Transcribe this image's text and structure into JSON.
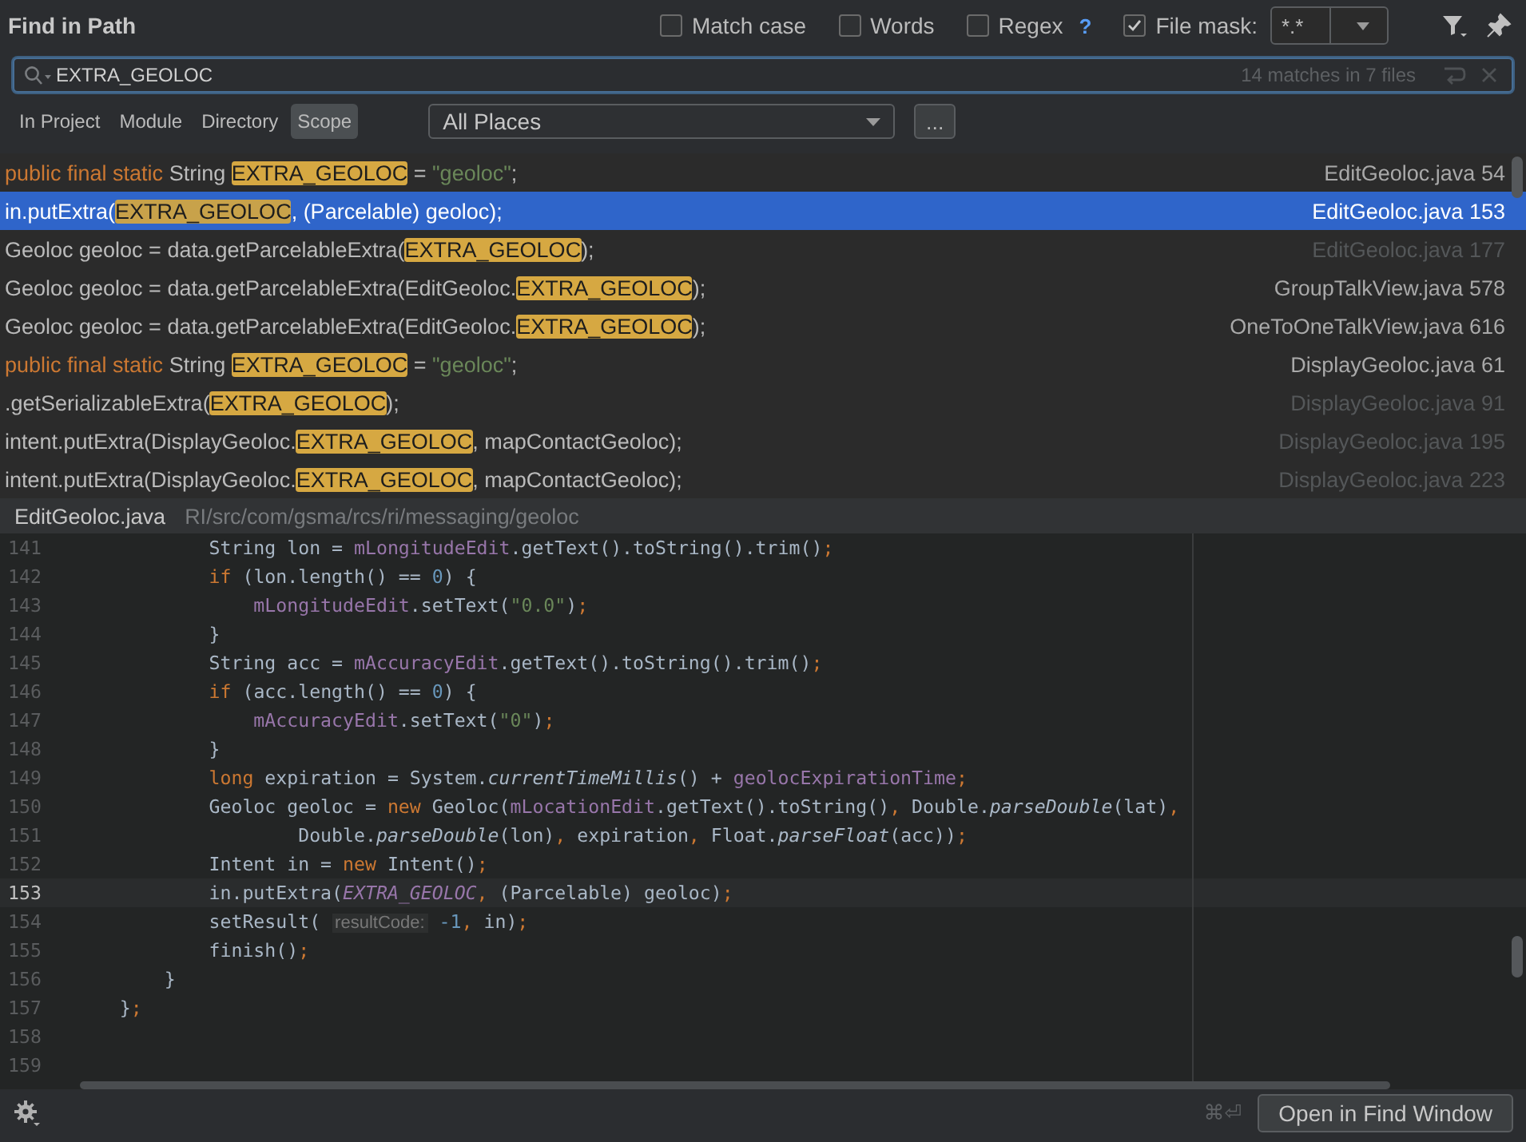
{
  "dialog": {
    "title": "Find in Path"
  },
  "options": [
    {
      "label": "Match case",
      "checked": false
    },
    {
      "label": "Words",
      "checked": false
    },
    {
      "label": "Regex",
      "checked": false,
      "help": "?"
    },
    {
      "label": "File mask:",
      "checked": true
    }
  ],
  "file_mask": {
    "value": "*.*"
  },
  "search": {
    "value": "EXTRA_GEOLOC",
    "summary": "14 matches in 7 files"
  },
  "scope_tabs": [
    {
      "label": "In Project",
      "selected": false
    },
    {
      "label": "Module",
      "selected": false
    },
    {
      "label": "Directory",
      "selected": false
    },
    {
      "label": "Scope",
      "selected": true
    }
  ],
  "scope_dropdown": {
    "value": "All Places"
  },
  "more_button": "...",
  "results": [
    {
      "segments": [
        {
          "text": "public final static",
          "kind": "keyword"
        },
        {
          "text": " String ",
          "kind": "plain"
        },
        {
          "text": "EXTRA_GEOLOC",
          "kind": "match"
        },
        {
          "text": " = ",
          "kind": "plain"
        },
        {
          "text": "\"geoloc\"",
          "kind": "string"
        },
        {
          "text": ";",
          "kind": "plain"
        }
      ],
      "file": "EditGeoloc.java",
      "line": "54",
      "file_dimmed": false,
      "selected": false
    },
    {
      "segments": [
        {
          "text": "in.putExtra(",
          "kind": "plain"
        },
        {
          "text": "EXTRA_GEOLOC",
          "kind": "match"
        },
        {
          "text": ", (Parcelable) geoloc);",
          "kind": "plain"
        }
      ],
      "file": "EditGeoloc.java",
      "line": "153",
      "file_dimmed": false,
      "selected": true
    },
    {
      "segments": [
        {
          "text": "Geoloc geoloc = data.getParcelableExtra(",
          "kind": "plain"
        },
        {
          "text": "EXTRA_GEOLOC",
          "kind": "match"
        },
        {
          "text": ");",
          "kind": "plain"
        }
      ],
      "file": "EditGeoloc.java",
      "line": "177",
      "file_dimmed": true,
      "selected": false
    },
    {
      "segments": [
        {
          "text": "Geoloc geoloc = data.getParcelableExtra(EditGeoloc.",
          "kind": "plain"
        },
        {
          "text": "EXTRA_GEOLOC",
          "kind": "match"
        },
        {
          "text": ");",
          "kind": "plain"
        }
      ],
      "file": "GroupTalkView.java",
      "line": "578",
      "file_dimmed": false,
      "selected": false
    },
    {
      "segments": [
        {
          "text": "Geoloc geoloc = data.getParcelableExtra(EditGeoloc.",
          "kind": "plain"
        },
        {
          "text": "EXTRA_GEOLOC",
          "kind": "match"
        },
        {
          "text": ");",
          "kind": "plain"
        }
      ],
      "file": "OneToOneTalkView.java",
      "line": "616",
      "file_dimmed": false,
      "selected": false
    },
    {
      "segments": [
        {
          "text": "public final static",
          "kind": "keyword"
        },
        {
          "text": " String ",
          "kind": "plain"
        },
        {
          "text": "EXTRA_GEOLOC",
          "kind": "match"
        },
        {
          "text": " = ",
          "kind": "plain"
        },
        {
          "text": "\"geoloc\"",
          "kind": "string"
        },
        {
          "text": ";",
          "kind": "plain"
        }
      ],
      "file": "DisplayGeoloc.java",
      "line": "61",
      "file_dimmed": false,
      "selected": false
    },
    {
      "segments": [
        {
          "text": ".getSerializableExtra(",
          "kind": "plain"
        },
        {
          "text": "EXTRA_GEOLOC",
          "kind": "match"
        },
        {
          "text": ");",
          "kind": "plain"
        }
      ],
      "file": "DisplayGeoloc.java",
      "line": "91",
      "file_dimmed": true,
      "selected": false
    },
    {
      "segments": [
        {
          "text": "intent.putExtra(DisplayGeoloc.",
          "kind": "plain"
        },
        {
          "text": "EXTRA_GEOLOC",
          "kind": "match"
        },
        {
          "text": ", mapContactGeoloc);",
          "kind": "plain"
        }
      ],
      "file": "DisplayGeoloc.java",
      "line": "195",
      "file_dimmed": true,
      "selected": false
    },
    {
      "segments": [
        {
          "text": "intent.putExtra(DisplayGeoloc.",
          "kind": "plain"
        },
        {
          "text": "EXTRA_GEOLOC",
          "kind": "match"
        },
        {
          "text": ", mapContactGeoloc);",
          "kind": "plain"
        }
      ],
      "file": "DisplayGeoloc.java",
      "line": "223",
      "file_dimmed": true,
      "selected": false
    }
  ],
  "preview": {
    "file": "EditGeoloc.java",
    "path": "RI/src/com/gsma/rcs/ri/messaging/geoloc",
    "lines": [
      {
        "number": "141",
        "current": false,
        "tokens": [
          {
            "text": "            String lon = ",
            "kind": "plain"
          },
          {
            "text": "mLongitudeEdit",
            "kind": "field"
          },
          {
            "text": ".getText().toString().trim()",
            "kind": "plain"
          },
          {
            "text": ";",
            "kind": "punct"
          }
        ]
      },
      {
        "number": "142",
        "current": false,
        "tokens": [
          {
            "text": "            if",
            "kind": "keyword"
          },
          {
            "text": " (lon.length() == ",
            "kind": "plain"
          },
          {
            "text": "0",
            "kind": "number"
          },
          {
            "text": ") {",
            "kind": "plain"
          }
        ]
      },
      {
        "number": "143",
        "current": false,
        "tokens": [
          {
            "text": "                mLongitudeEdit",
            "kind": "field"
          },
          {
            "text": ".setText(",
            "kind": "plain"
          },
          {
            "text": "\"0.0\"",
            "kind": "string"
          },
          {
            "text": ")",
            "kind": "plain"
          },
          {
            "text": ";",
            "kind": "punct"
          }
        ]
      },
      {
        "number": "144",
        "current": false,
        "tokens": [
          {
            "text": "            }",
            "kind": "plain"
          }
        ]
      },
      {
        "number": "145",
        "current": false,
        "tokens": [
          {
            "text": "            String acc = ",
            "kind": "plain"
          },
          {
            "text": "mAccuracyEdit",
            "kind": "field"
          },
          {
            "text": ".getText().toString().trim()",
            "kind": "plain"
          },
          {
            "text": ";",
            "kind": "punct"
          }
        ]
      },
      {
        "number": "146",
        "current": false,
        "tokens": [
          {
            "text": "            if",
            "kind": "keyword"
          },
          {
            "text": " (acc.length() == ",
            "kind": "plain"
          },
          {
            "text": "0",
            "kind": "number"
          },
          {
            "text": ") {",
            "kind": "plain"
          }
        ]
      },
      {
        "number": "147",
        "current": false,
        "tokens": [
          {
            "text": "                mAccuracyEdit",
            "kind": "field"
          },
          {
            "text": ".setText(",
            "kind": "plain"
          },
          {
            "text": "\"0\"",
            "kind": "string"
          },
          {
            "text": ")",
            "kind": "plain"
          },
          {
            "text": ";",
            "kind": "punct"
          }
        ]
      },
      {
        "number": "148",
        "current": false,
        "tokens": [
          {
            "text": "            }",
            "kind": "plain"
          }
        ]
      },
      {
        "number": "149",
        "current": false,
        "tokens": [
          {
            "text": "            long",
            "kind": "keyword"
          },
          {
            "text": " expiration = System.",
            "kind": "plain"
          },
          {
            "text": "currentTimeMillis",
            "kind": "method"
          },
          {
            "text": "() + ",
            "kind": "plain"
          },
          {
            "text": "geolocExpirationTime",
            "kind": "field"
          },
          {
            "text": ";",
            "kind": "punct"
          }
        ]
      },
      {
        "number": "150",
        "current": false,
        "tokens": [
          {
            "text": "            Geoloc geoloc = ",
            "kind": "plain"
          },
          {
            "text": "new",
            "kind": "keyword"
          },
          {
            "text": " Geoloc(",
            "kind": "plain"
          },
          {
            "text": "mLocationEdit",
            "kind": "field"
          },
          {
            "text": ".getText().toString()",
            "kind": "plain"
          },
          {
            "text": ",",
            "kind": "punct"
          },
          {
            "text": " Double.",
            "kind": "plain"
          },
          {
            "text": "parseDouble",
            "kind": "method"
          },
          {
            "text": "(lat)",
            "kind": "plain"
          },
          {
            "text": ",",
            "kind": "punct"
          }
        ]
      },
      {
        "number": "151",
        "current": false,
        "tokens": [
          {
            "text": "                    Double.",
            "kind": "plain"
          },
          {
            "text": "parseDouble",
            "kind": "method"
          },
          {
            "text": "(lon)",
            "kind": "plain"
          },
          {
            "text": ",",
            "kind": "punct"
          },
          {
            "text": " expiration",
            "kind": "plain"
          },
          {
            "text": ",",
            "kind": "punct"
          },
          {
            "text": " Float.",
            "kind": "plain"
          },
          {
            "text": "parseFloat",
            "kind": "method"
          },
          {
            "text": "(acc))",
            "kind": "plain"
          },
          {
            "text": ";",
            "kind": "punct"
          }
        ]
      },
      {
        "number": "152",
        "current": false,
        "tokens": [
          {
            "text": "            Intent in = ",
            "kind": "plain"
          },
          {
            "text": "new",
            "kind": "keyword"
          },
          {
            "text": " Intent()",
            "kind": "plain"
          },
          {
            "text": ";",
            "kind": "punct"
          }
        ]
      },
      {
        "number": "153",
        "current": true,
        "tokens": [
          {
            "text": "            in.putExtra(",
            "kind": "plain"
          },
          {
            "text": "EXTRA_GEOLOC",
            "kind": "constant"
          },
          {
            "text": ",",
            "kind": "punct"
          },
          {
            "text": " (Parcelable) geoloc)",
            "kind": "plain"
          },
          {
            "text": ";",
            "kind": "punct"
          }
        ]
      },
      {
        "number": "154",
        "current": false,
        "tokens": [
          {
            "text": "            setResult( ",
            "kind": "plain"
          },
          {
            "text": "resultCode:",
            "kind": "hint"
          },
          {
            "text": " -1",
            "kind": "number"
          },
          {
            "text": ",",
            "kind": "punct"
          },
          {
            "text": " in)",
            "kind": "plain"
          },
          {
            "text": ";",
            "kind": "punct"
          }
        ]
      },
      {
        "number": "155",
        "current": false,
        "tokens": [
          {
            "text": "            finish()",
            "kind": "plain"
          },
          {
            "text": ";",
            "kind": "punct"
          }
        ]
      },
      {
        "number": "156",
        "current": false,
        "tokens": [
          {
            "text": "        }",
            "kind": "plain"
          }
        ]
      },
      {
        "number": "157",
        "current": false,
        "tokens": [
          {
            "text": "    }",
            "kind": "plain"
          },
          {
            "text": ";",
            "kind": "punct"
          }
        ]
      },
      {
        "number": "158",
        "current": false
      },
      {
        "number": "159",
        "current": false
      }
    ]
  },
  "footer": {
    "shortcut": "⌘⏎",
    "button": "Open in Find Window"
  }
}
